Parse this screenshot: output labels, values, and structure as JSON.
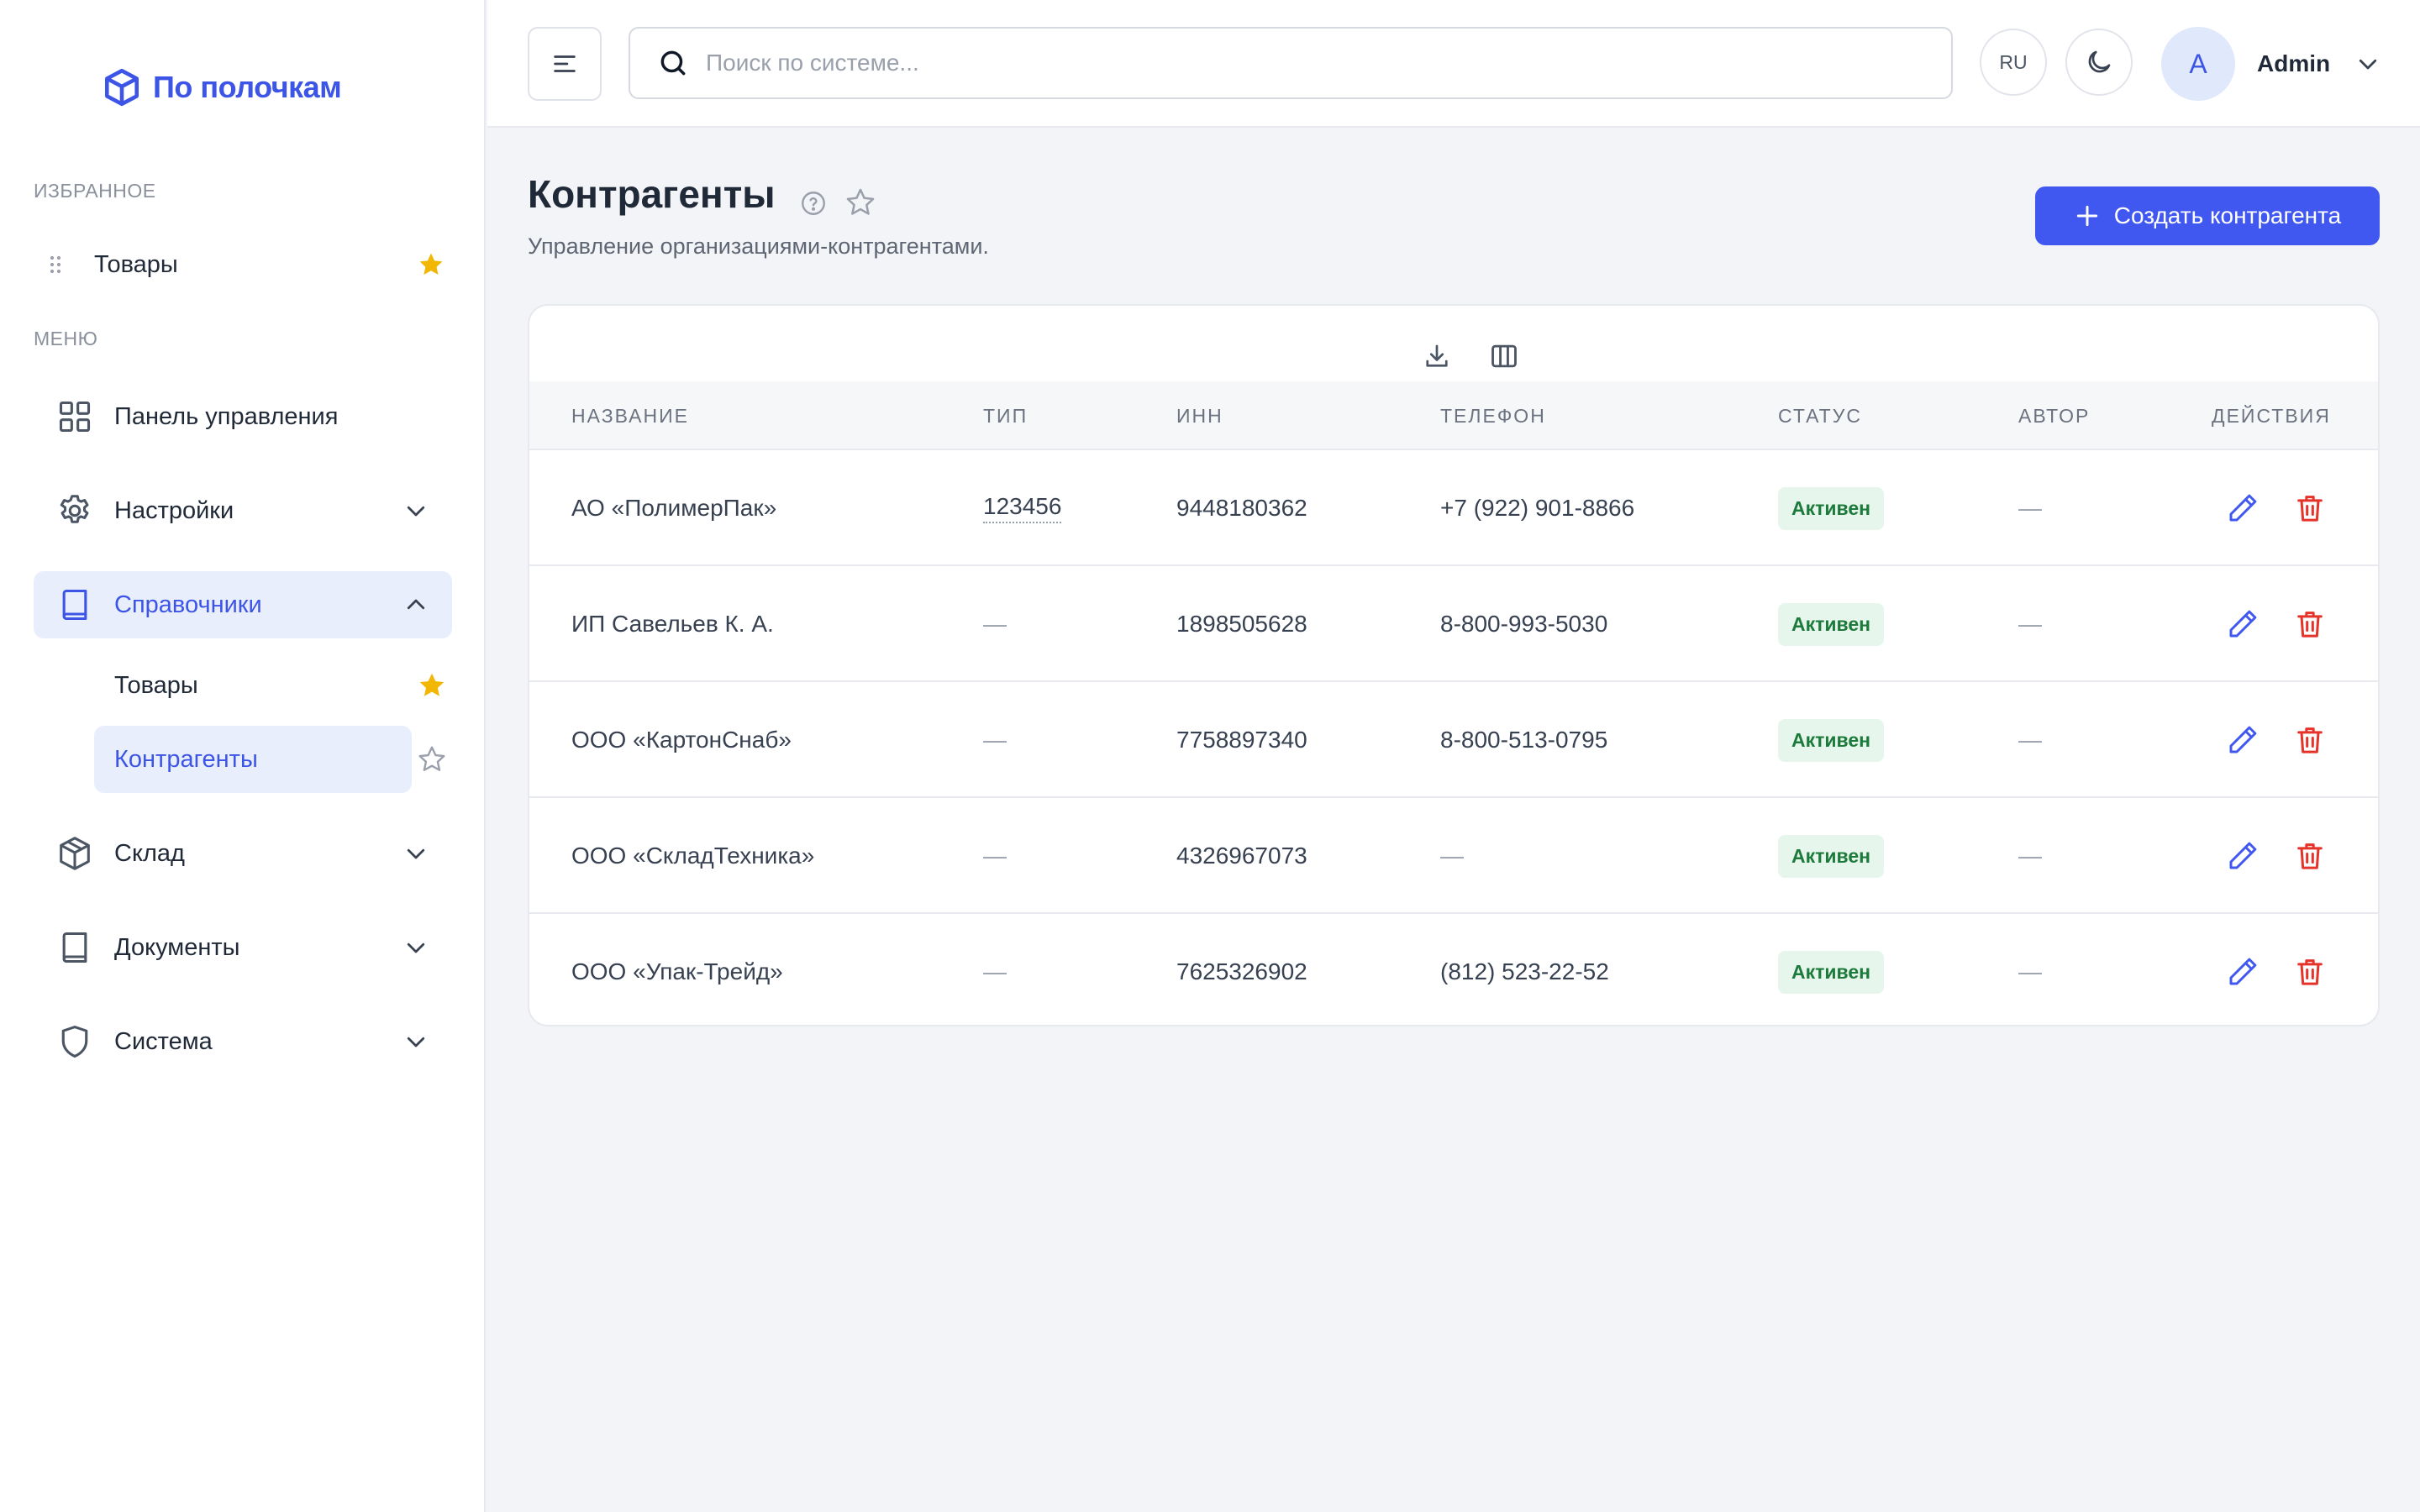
{
  "app": {
    "logo_text": "По полочкам",
    "brand_color": "#3d55e6"
  },
  "sidebar": {
    "favorites_title": "ИЗБРАННОЕ",
    "favorites": [
      {
        "label": "Товары",
        "starred": true
      }
    ],
    "menu_title": "МЕНЮ",
    "items": [
      {
        "label": "Панель управления",
        "icon": "grid-icon"
      },
      {
        "label": "Настройки",
        "icon": "gear-icon",
        "expandable": true
      },
      {
        "label": "Справочники",
        "icon": "book-icon",
        "expandable": true,
        "expanded": true,
        "active": true,
        "children": [
          {
            "label": "Товары",
            "starred": true
          },
          {
            "label": "Контрагенты",
            "starred": false,
            "active": true
          }
        ]
      },
      {
        "label": "Склад",
        "icon": "box-icon",
        "expandable": true
      },
      {
        "label": "Документы",
        "icon": "document-icon",
        "expandable": true
      },
      {
        "label": "Система",
        "icon": "shield-icon",
        "expandable": true
      }
    ]
  },
  "header": {
    "search_placeholder": "Поиск по системе...",
    "language": "RU",
    "user": {
      "initial": "A",
      "name": "Admin"
    }
  },
  "page": {
    "title": "Контрагенты",
    "subtitle": "Управление организациями-контрагентами.",
    "create_button": "Создать контрагента"
  },
  "table": {
    "columns": [
      "НАЗВАНИЕ",
      "ТИП",
      "ИНН",
      "ТЕЛЕФОН",
      "СТАТУС",
      "АВТОР",
      "ДЕЙСТВИЯ"
    ],
    "rows": [
      {
        "name": "АО «ПолимерПак»",
        "type": "123456",
        "inn": "9448180362",
        "phone": "+7 (922) 901-8866",
        "status": "Активен",
        "author": "—"
      },
      {
        "name": "ИП Савельев К. А.",
        "type": "—",
        "inn": "1898505628",
        "phone": "8-800-993-5030",
        "status": "Активен",
        "author": "—"
      },
      {
        "name": "ООО «КартонСнаб»",
        "type": "—",
        "inn": "7758897340",
        "phone": "8-800-513-0795",
        "status": "Активен",
        "author": "—"
      },
      {
        "name": "ООО «СкладТехника»",
        "type": "—",
        "inn": "4326967073",
        "phone": "—",
        "status": "Активен",
        "author": "—"
      },
      {
        "name": "ООО «Упак-Трейд»",
        "type": "—",
        "inn": "7625326902",
        "phone": "(812) 523-22-52",
        "status": "Активен",
        "author": "—"
      }
    ]
  },
  "colors": {
    "accent": "#4158f0",
    "star": "#f2b705",
    "status_bg": "#e7f6ec",
    "status_text": "#1c7a3b",
    "delete": "#e5332a"
  }
}
